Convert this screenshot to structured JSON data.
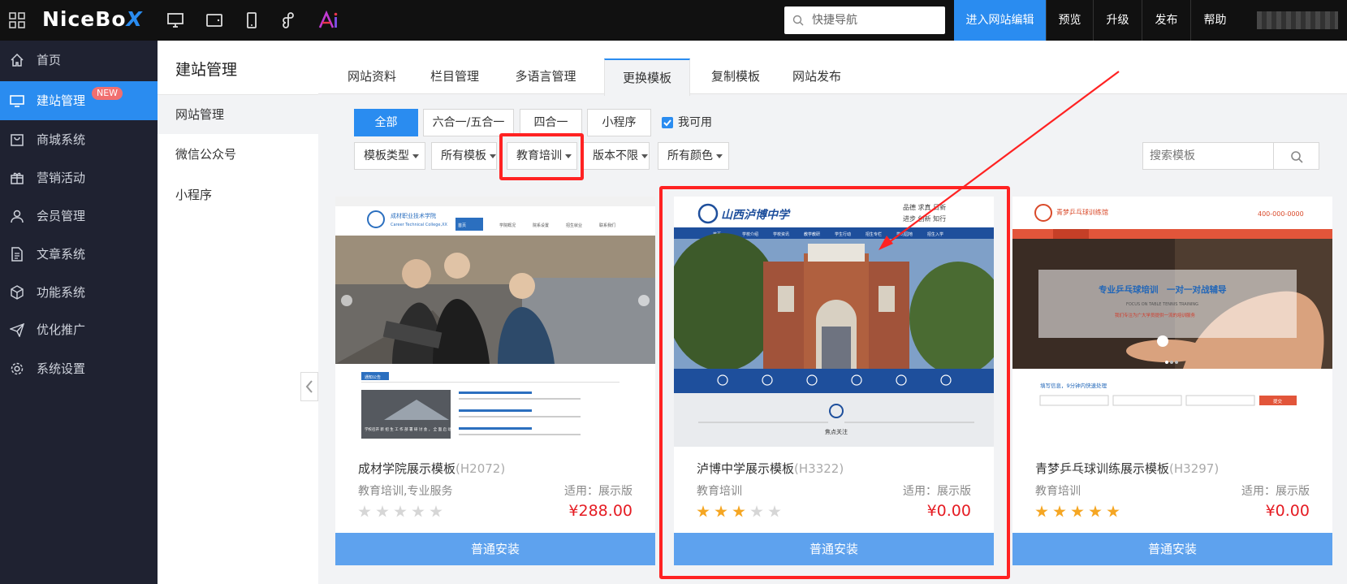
{
  "topbar": {
    "logo_main": "NiceBo",
    "logo_x": "X",
    "search_placeholder": "快捷导航",
    "edit_site": "进入网站编辑",
    "buttons": [
      "预览",
      "升级",
      "发布",
      "帮助"
    ],
    "device_icons": [
      "desktop-icon",
      "tablet-icon",
      "mobile-icon",
      "mini-program-icon",
      "ai-icon"
    ]
  },
  "sidebar": {
    "items": [
      {
        "label": "首页",
        "icon": "home-icon"
      },
      {
        "label": "建站管理",
        "icon": "monitor-icon",
        "badge": "NEW",
        "active": true
      },
      {
        "label": "商城系统",
        "icon": "shop-icon"
      },
      {
        "label": "营销活动",
        "icon": "gift-icon"
      },
      {
        "label": "会员管理",
        "icon": "user-icon"
      },
      {
        "label": "文章系统",
        "icon": "document-icon"
      },
      {
        "label": "功能系统",
        "icon": "cube-icon"
      },
      {
        "label": "优化推广",
        "icon": "send-icon"
      },
      {
        "label": "系统设置",
        "icon": "gear-icon"
      }
    ]
  },
  "subnav": {
    "title": "建站管理",
    "items": [
      "网站管理",
      "微信公众号",
      "小程序"
    ]
  },
  "tabs": [
    "网站资料",
    "栏目管理",
    "多语言管理",
    "更换模板",
    "复制模板",
    "网站发布"
  ],
  "filters": {
    "types": [
      "全部",
      "六合一/五合一",
      "四合一",
      "小程序"
    ],
    "available_label": "我可用",
    "dropdowns": [
      "模板类型",
      "所有模板",
      "教育培训",
      "版本不限",
      "所有颜色"
    ],
    "search_placeholder": "搜索模板"
  },
  "cards": [
    {
      "name": "成材学院展示模板",
      "code": "(H2072)",
      "category": "教育培训,专业服务",
      "fit": "适用：展示版",
      "price": "¥288.00",
      "rating": 0,
      "install": "普通安装",
      "thumb": {
        "school": "成材职业技术学院",
        "school_en": "Career Technical College,XX",
        "nav": [
          "首页",
          "学院概况",
          "院系设置",
          "招生就业",
          "联系我们"
        ],
        "notice": "通知公告",
        "headline": "学校召开 新 招 生 工 作 部 署 研 讨 会 ， 全 面 启 动 今 年 招 生 工 作 专 题 会议"
      }
    },
    {
      "name": "泸博中学展示模板",
      "code": "(H3322)",
      "category": "教育培训",
      "fit": "适用：展示版",
      "price": "¥0.00",
      "rating": 3,
      "install": "普通安装",
      "thumb": {
        "school": "山西泸博中学",
        "motto_1": "品德 求真 日新",
        "motto_2": "进步 创新 知行",
        "section": "焦点关注",
        "nav": [
          "首页",
          "学校介绍",
          "学校资讯",
          "教学教研",
          "学生行动",
          "招生专栏",
          "学习园地",
          "招生入学"
        ]
      }
    },
    {
      "name": "青梦乒乓球训练展示模板",
      "code": "(H3297)",
      "category": "教育培训",
      "fit": "适用：展示版",
      "price": "¥0.00",
      "rating": 5,
      "install": "普通安装",
      "thumb": {
        "club": "青梦乒乓球训练馆",
        "phone": "400-000-0000",
        "banner_title": "专业乒乓球培训　一对一对战辅导",
        "banner_sub": "FOCUS ON TABLE TENNIS TRAINING",
        "banner_note": "我们专注为广大学员提供一流的培训服务",
        "form_title": "填写信息，9分钟内快速处理",
        "form_btn": "提交"
      }
    }
  ],
  "colors": {
    "accent": "#2a8cf0",
    "install": "#5ea2ee",
    "price": "#e51c23",
    "star": "#f5a623",
    "highlight": "#ff2222",
    "sidebar": "#1f2231"
  }
}
